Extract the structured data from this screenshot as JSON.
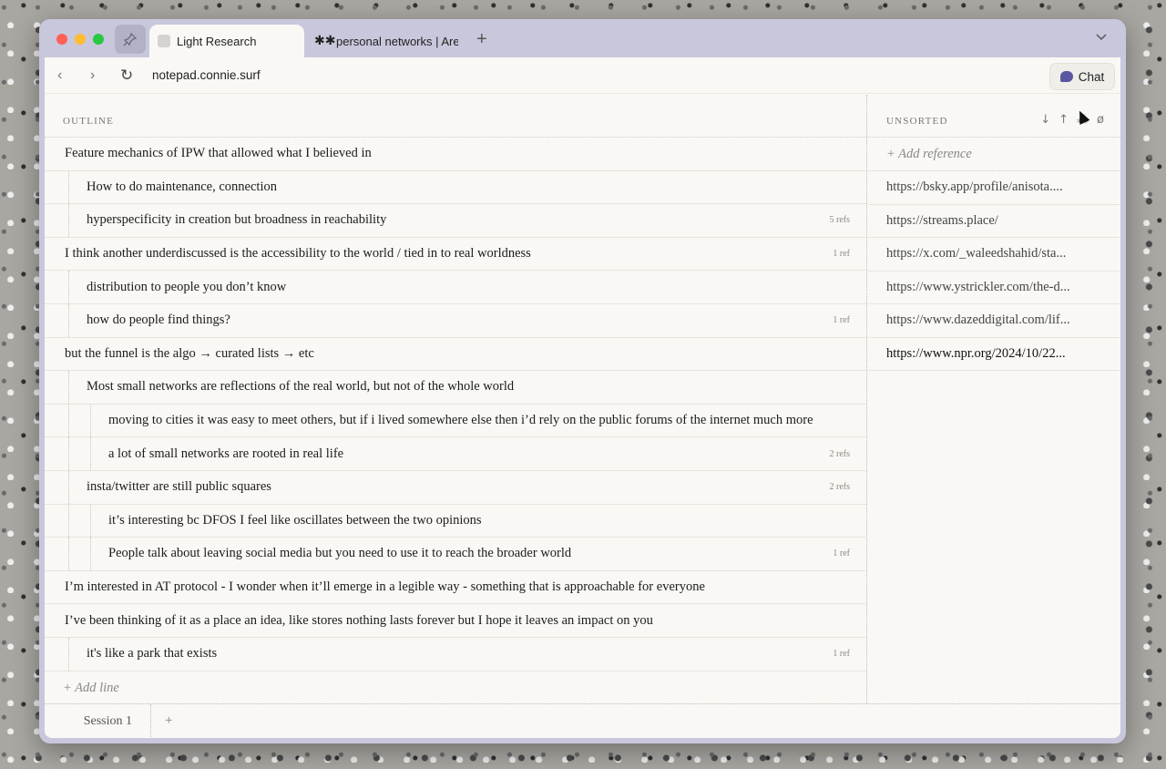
{
  "browser": {
    "tabs": [
      {
        "label": "Light Research"
      },
      {
        "label": "personal networks | Are.na",
        "icon": "asterisks-icon"
      }
    ],
    "new_tab_symbol": "+",
    "tab_menu_symbol": "⌄",
    "url": "notepad.connie.surf",
    "chat_label": "Chat"
  },
  "outline": {
    "label": "OUTLINE",
    "rows": [
      {
        "text": "Feature mechanics of IPW that allowed what I believed in",
        "level": 0,
        "refs": ""
      },
      {
        "text": "How to do maintenance, connection",
        "level": 1,
        "refs": ""
      },
      {
        "text": "hyperspecificity in creation but broadness in reachability",
        "level": 1,
        "refs": "5 refs"
      },
      {
        "text": "I think another underdiscussed is the accessibility to the world / tied in to real worldness",
        "level": 0,
        "refs": "1 ref"
      },
      {
        "text": "distribution to people you don’t know",
        "level": 1,
        "refs": ""
      },
      {
        "text": "how do people find things?",
        "level": 1,
        "refs": "1 ref"
      },
      {
        "text": "but the funnel is the algo → curated lists → etc",
        "level": 0,
        "refs": ""
      },
      {
        "text": "Most small networks are reflections of the real world, but not of the whole world",
        "level": 1,
        "refs": ""
      },
      {
        "text": "moving to cities it was easy to meet others, but if i lived somewhere else then i’d rely on the public forums of the internet much more",
        "level": 2,
        "refs": ""
      },
      {
        "text": "a lot of small networks are rooted in real life",
        "level": 2,
        "refs": "2 refs"
      },
      {
        "text": "insta/twitter are still public squares",
        "level": 1,
        "refs": "2 refs"
      },
      {
        "text": "it’s interesting bc DFOS I feel like oscillates between the two opinions",
        "level": 2,
        "refs": ""
      },
      {
        "text": "People talk about leaving social media but you need to use it to reach the broader world",
        "level": 2,
        "refs": "1 ref"
      },
      {
        "text": "I’m interested in AT protocol - I wonder when it’ll emerge in a legible way - something that is approachable for everyone",
        "level": 0,
        "refs": ""
      },
      {
        "text": "I’ve been thinking of it as a place an idea, like stores nothing lasts forever but I hope it leaves an impact on you",
        "level": 0,
        "refs": ""
      },
      {
        "text": "it's like a park that exists",
        "level": 1,
        "refs": "1 ref"
      }
    ],
    "add_line": "+ Add line"
  },
  "unsorted": {
    "label": "UNSORTED",
    "tools": [
      "↓",
      "↑",
      "⁂",
      "ø"
    ],
    "add_reference": "+ Add reference",
    "refs": [
      "https://bsky.app/profile/anisota....",
      "https://streams.place/",
      "https://x.com/_waleedshahid/sta...",
      "https://www.ystrickler.com/the-d...",
      "https://www.dazeddigital.com/lif...",
      "https://www.npr.org/2024/10/22..."
    ]
  },
  "sessions": {
    "tabs": [
      "Session 1"
    ],
    "add_symbol": "+"
  }
}
